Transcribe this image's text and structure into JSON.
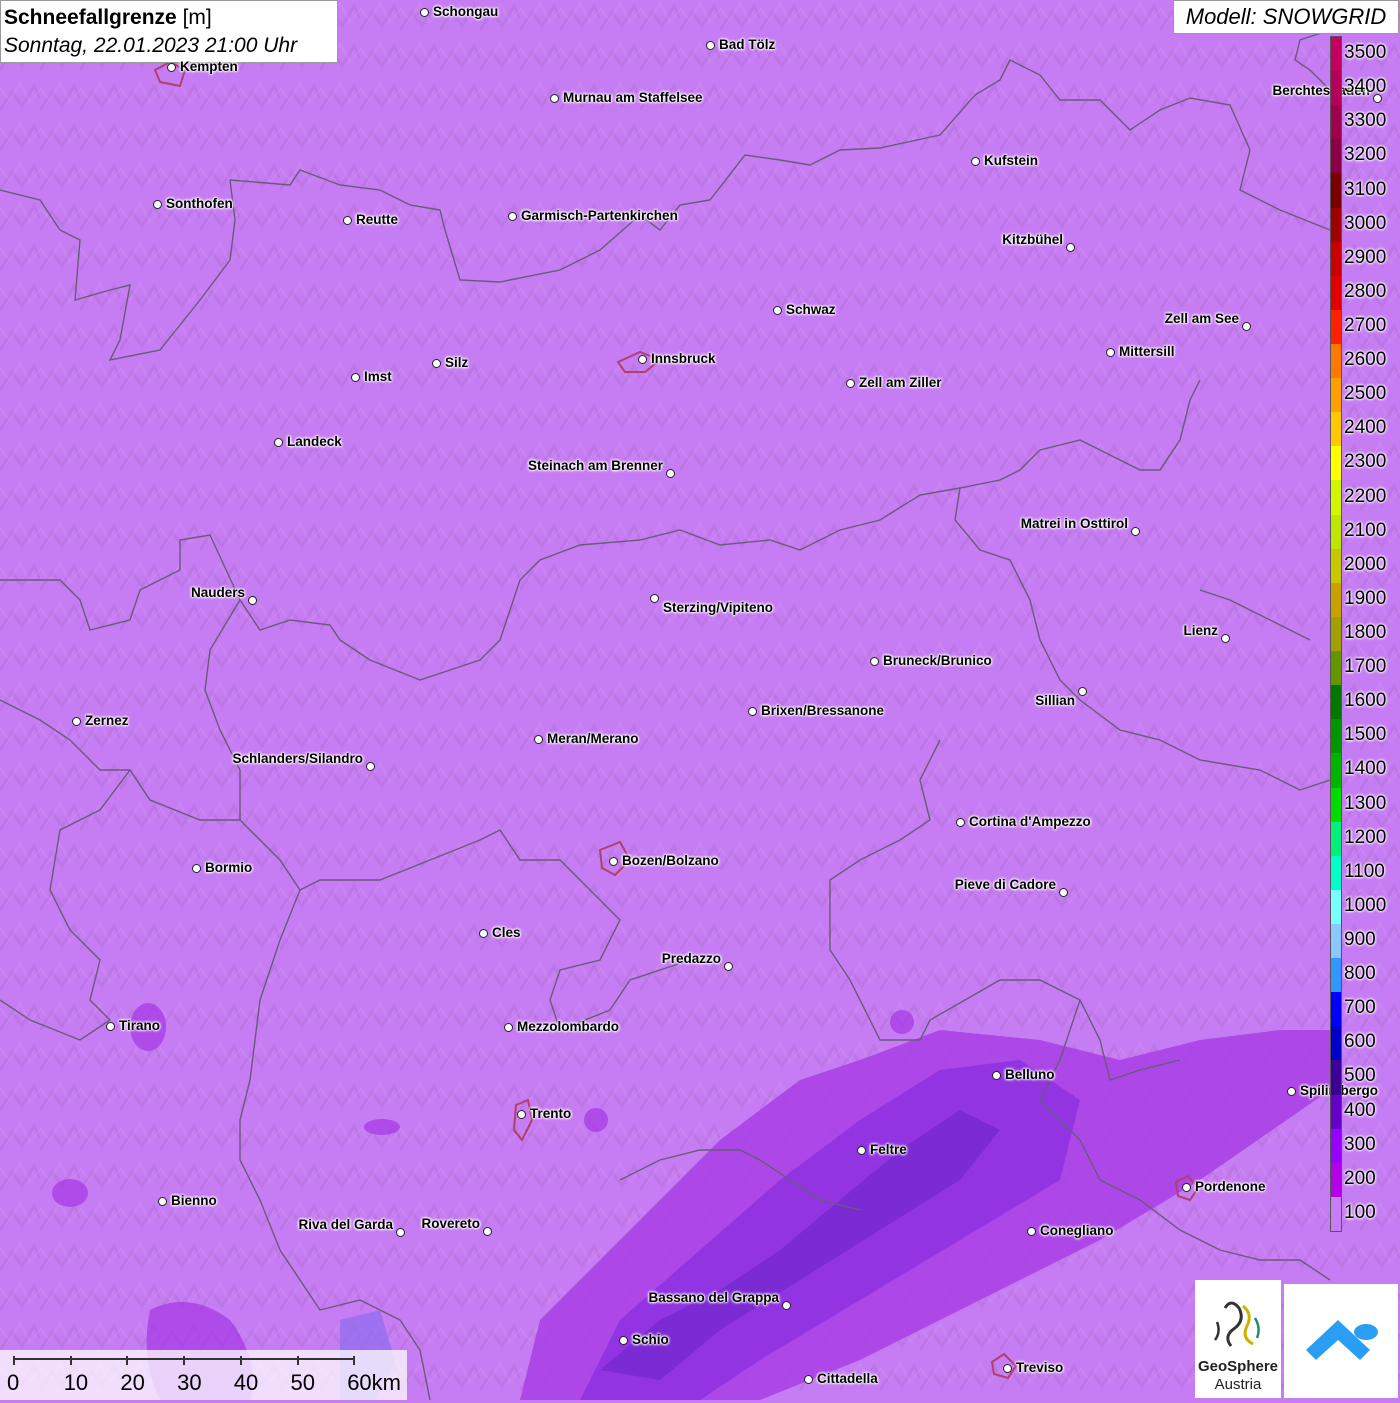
{
  "header": {
    "title_bold": "Schneefallgrenze",
    "title_unit": "[m]",
    "subtitle": "Sonntag, 22.01.2023 21:00 Uhr",
    "model": "Modell: SNOWGRID"
  },
  "legend": {
    "values": [
      "3500",
      "3400",
      "3300",
      "3200",
      "3100",
      "3000",
      "2900",
      "2800",
      "2700",
      "2600",
      "2500",
      "2400",
      "2300",
      "2200",
      "2100",
      "2000",
      "1900",
      "1800",
      "1700",
      "1600",
      "1500",
      "1400",
      "1300",
      "1200",
      "1100",
      "1000",
      "900",
      "800",
      "700",
      "600",
      "500",
      "400",
      "300",
      "200",
      "100"
    ],
    "colors": [
      "#c4005e",
      "#b4005a",
      "#a00050",
      "#8c0046",
      "#780000",
      "#a00000",
      "#c80000",
      "#e00000",
      "#ff2000",
      "#ff7800",
      "#ffa000",
      "#ffc800",
      "#ffff00",
      "#d2f500",
      "#bee600",
      "#c8c800",
      "#c8a000",
      "#a0a000",
      "#649600",
      "#007800",
      "#009600",
      "#00b400",
      "#00dc00",
      "#00f07a",
      "#00ffc8",
      "#78ffff",
      "#8cc8ff",
      "#3296ff",
      "#0000ff",
      "#0000c8",
      "#3c0096",
      "#6400c8",
      "#9600ff",
      "#b400e6",
      "#c87cf5"
    ]
  },
  "cities": [
    {
      "name": "Schongau"
    },
    {
      "name": "Bad Tölz"
    },
    {
      "name": "Kempten"
    },
    {
      "name": "Murnau am Staffelsee"
    },
    {
      "name": "Berchtesgaden"
    },
    {
      "name": "Kufstein"
    },
    {
      "name": "Sonthofen"
    },
    {
      "name": "Reutte"
    },
    {
      "name": "Garmisch-Partenkirchen"
    },
    {
      "name": "Kitzbühel"
    },
    {
      "name": "Schwaz"
    },
    {
      "name": "Zell am See"
    },
    {
      "name": "Innsbruck"
    },
    {
      "name": "Mittersill"
    },
    {
      "name": "Silz"
    },
    {
      "name": "Imst"
    },
    {
      "name": "Zell am Ziller"
    },
    {
      "name": "Landeck"
    },
    {
      "name": "Steinach am Brenner"
    },
    {
      "name": "Matrei in Osttirol"
    },
    {
      "name": "Nauders"
    },
    {
      "name": "Sterzing/Vipiteno"
    },
    {
      "name": "Lienz"
    },
    {
      "name": "Bruneck/Brunico"
    },
    {
      "name": "Sillian"
    },
    {
      "name": "Brixen/Bressanone"
    },
    {
      "name": "Zernez"
    },
    {
      "name": "Meran/Merano"
    },
    {
      "name": "Schlanders/Silandro"
    },
    {
      "name": "Cortina d'Ampezzo"
    },
    {
      "name": "Bormio"
    },
    {
      "name": "Bozen/Bolzano"
    },
    {
      "name": "Pieve di Cadore"
    },
    {
      "name": "Cles"
    },
    {
      "name": "Predazzo"
    },
    {
      "name": "Tirano"
    },
    {
      "name": "Mezzolombardo"
    },
    {
      "name": "Belluno"
    },
    {
      "name": "Spilimbergo"
    },
    {
      "name": "Trento"
    },
    {
      "name": "Feltre"
    },
    {
      "name": "Pordenone"
    },
    {
      "name": "Bienno"
    },
    {
      "name": "Riva del Garda"
    },
    {
      "name": "Rovereto"
    },
    {
      "name": "Conegliano"
    },
    {
      "name": "Bassano del Grappa"
    },
    {
      "name": "Schio"
    },
    {
      "name": "Treviso"
    },
    {
      "name": "Cittadella"
    }
  ],
  "scale": {
    "labels": [
      "0",
      "10",
      "20",
      "30",
      "40",
      "50",
      "60km"
    ]
  },
  "logos": {
    "geosphere_line1": "GeoSphere",
    "geosphere_line2": "Austria"
  }
}
